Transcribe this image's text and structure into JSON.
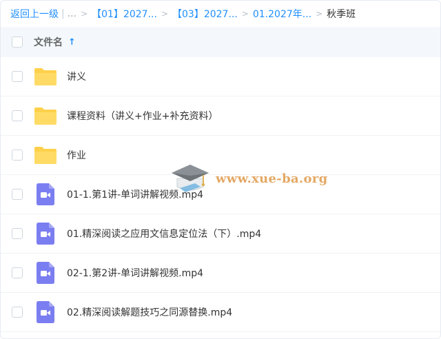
{
  "breadcrumb": {
    "back": "返回上一级",
    "ellipsis": "...",
    "items": [
      "【01】2027...",
      "【03】2027...",
      "01.2027年..."
    ],
    "current": "秋季班"
  },
  "header": {
    "title": "文件名",
    "sort_icon": "arrow-up-icon",
    "accent_color": "#1f8fff",
    "header_bg": "#f4f8fc"
  },
  "files": [
    {
      "type": "folder",
      "name": "讲义"
    },
    {
      "type": "folder",
      "name": "课程资料（讲义+作业+补充资料）"
    },
    {
      "type": "folder",
      "name": "作业"
    },
    {
      "type": "video",
      "name": "01-1.第1讲-单词讲解视频.mp4"
    },
    {
      "type": "video",
      "name": "01.精深阅读之应用文信息定位法（下）.mp4"
    },
    {
      "type": "video",
      "name": "02-1.第2讲-单词讲解视频.mp4"
    },
    {
      "type": "video",
      "name": "02.精深阅读解题技巧之同源替换.mp4"
    }
  ],
  "icons": {
    "folder": "folder-icon",
    "video": "video-file-icon",
    "folder_color": "#ffd04b",
    "video_color": "#7b7ef0"
  },
  "watermark": {
    "text": "www.xue-ba.org",
    "icon": "graduation-cap-icon"
  }
}
